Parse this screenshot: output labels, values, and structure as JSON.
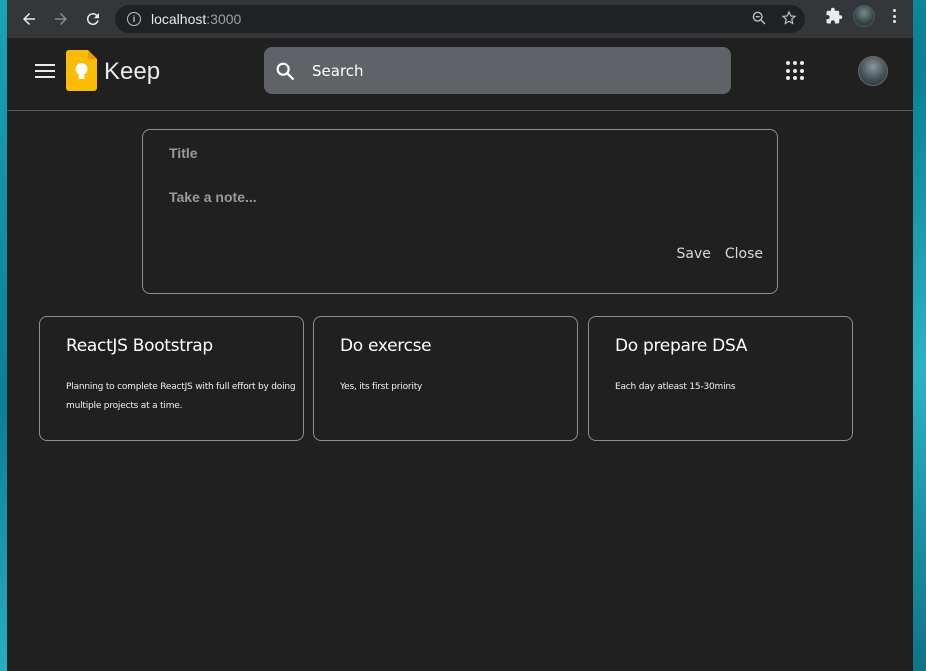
{
  "browser": {
    "url_host": "localhost",
    "url_port": ":3000"
  },
  "header": {
    "app_title": "Keep",
    "search": {
      "placeholder": "Search"
    }
  },
  "composer": {
    "title_placeholder": "Title",
    "note_placeholder": "Take a note...",
    "save_label": "Save",
    "close_label": "Close"
  },
  "notes": [
    {
      "title": "ReactJS Bootstrap",
      "body": "Planning to complete ReactJS with full effort by doing multiple projects at a time."
    },
    {
      "title": "Do exercse",
      "body": "Yes, its first priority"
    },
    {
      "title": "Do prepare DSA",
      "body": "Each day atleast 15-30mins"
    }
  ],
  "colors": {
    "background": "#202020",
    "logo_yellow": "#fbbc04",
    "search_bg": "#5f6368"
  }
}
